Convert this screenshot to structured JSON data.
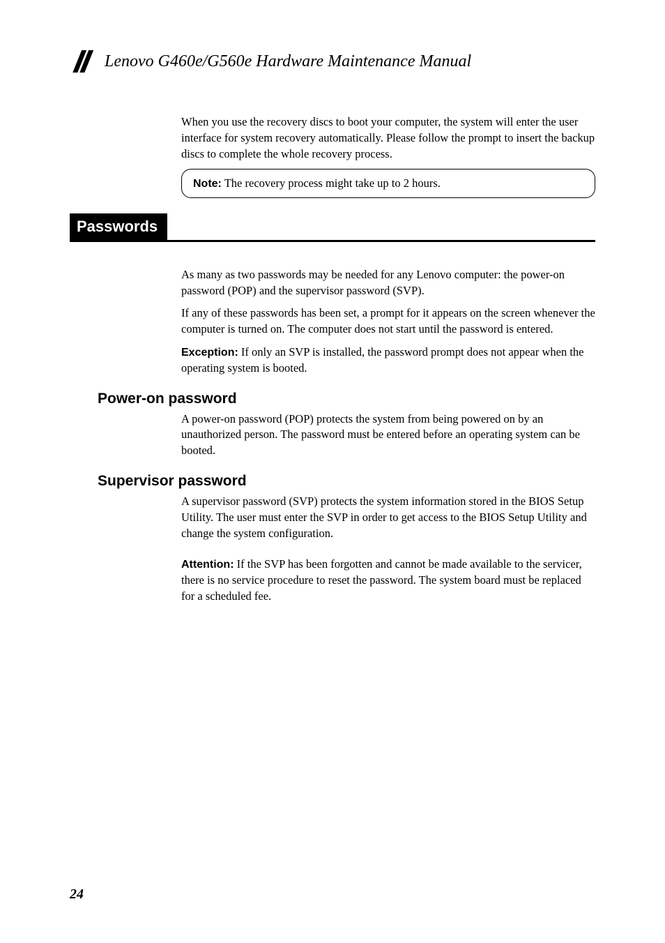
{
  "header": {
    "title": "Lenovo G460e/G560e Hardware Maintenance Manual"
  },
  "intro": {
    "p1": "When you use the recovery discs to boot your computer, the system will enter the user interface for system recovery automatically. Please follow the prompt to insert the backup discs to complete the whole recovery process.",
    "note_label": "Note:",
    "note_text": " The recovery process might take up to 2 hours."
  },
  "section": {
    "title": "Passwords",
    "p1": "As many as two passwords may be needed for any Lenovo computer: the power-on password (POP) and the supervisor password (SVP).",
    "p2": "If any of these passwords has been set, a prompt for it appears on the screen whenever the computer is turned on. The computer does not start until the password is entered.",
    "exc_label": "Exception:",
    "exc_text": " If only an SVP is installed, the password prompt does not appear when the operating system is booted."
  },
  "sub1": {
    "heading": "Power-on password",
    "p1": "A power-on password (POP) protects the system from being powered on by an unauthorized person. The password must be entered before an operating system can be booted."
  },
  "sub2": {
    "heading": "Supervisor password",
    "p1": "A supervisor password (SVP) protects the system information stored in the BIOS Setup Utility. The user must enter the SVP in order to get access to the BIOS Setup Utility and change the system configuration.",
    "attn_label": "Attention:",
    "attn_text": " If the SVP has been forgotten and cannot be made available to the servicer, there is no service procedure to reset the password. The system board must be replaced for a scheduled fee."
  },
  "page_number": "24"
}
